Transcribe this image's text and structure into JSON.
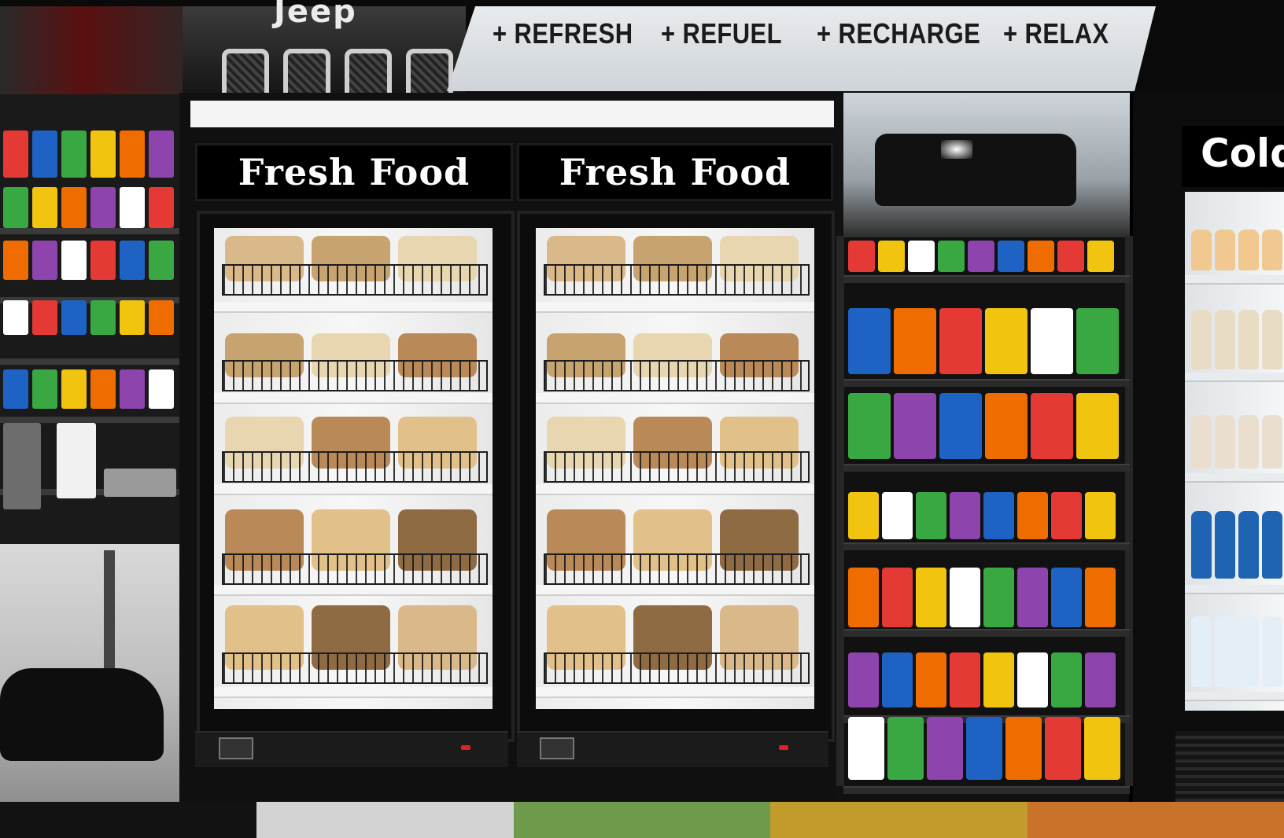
{
  "banner": {
    "brand_logo": "Jeep",
    "slogans": [
      "+ REFRESH",
      "+ REFUEL",
      "+ RECHARGE",
      "+ RELAX"
    ]
  },
  "fridge": {
    "sign_left": "Fresh Food",
    "sign_right": "Fresh Food"
  },
  "cold_cooler": {
    "sign_partial": "Cold"
  },
  "colors": {
    "strip": [
      "#121212",
      "#d3d3d3",
      "#6f9a4c",
      "#c39a2c",
      "#c8722a"
    ],
    "food_palette": [
      "#d9b98a",
      "#c7a36f",
      "#e7d6b0",
      "#b98a58",
      "#e1c089",
      "#8f6b43"
    ],
    "snack_palette": [
      "#e53935",
      "#1e63c4",
      "#3aa842",
      "#f1c40f",
      "#ef6c00",
      "#8e44ad",
      "#ffffff"
    ]
  }
}
